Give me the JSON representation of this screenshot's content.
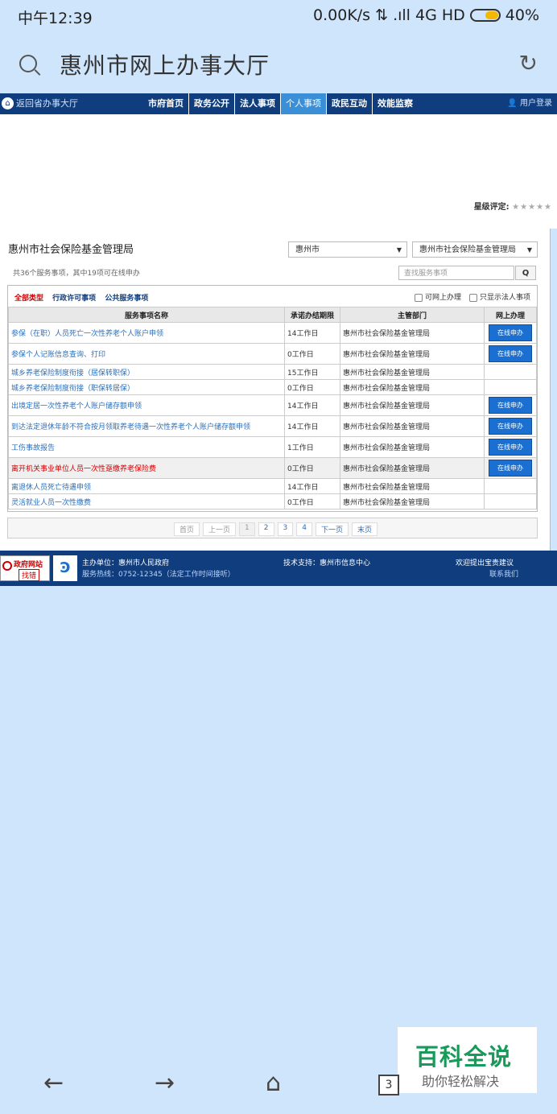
{
  "status_bar": {
    "time": "中午12:39",
    "network": "0.00K/s ⇅ .ıll 4G HD",
    "battery": "40%"
  },
  "browser": {
    "url_title": "惠州市网上办事大厅"
  },
  "nav": {
    "back_label": "返回省办事大厅",
    "items": [
      "市府首页",
      "政务公开",
      "法人事项",
      "个人事项",
      "政民互动",
      "效能监察"
    ],
    "active_item": "个人事项",
    "login_label": "用户登录"
  },
  "rating": {
    "label": "星级评定:",
    "stars": "★★★★★"
  },
  "panel": {
    "title": "惠州市社会保险基金管理局",
    "city_select": "惠州市",
    "dept_select": "惠州市社会保险基金管理局",
    "count_text": "共36个服务事项，其中19项可在线申办",
    "search_placeholder": "查找服务事项",
    "search_button": "Q",
    "filters": [
      "全部类型",
      "行政许可事项",
      "公共服务事项"
    ],
    "check_online": "可网上办理",
    "check_legal": "只显示法人事项",
    "columns": [
      "服务事项名称",
      "承诺办结期限",
      "主管部门",
      "网上办理"
    ],
    "rows": [
      {
        "name": "参保（在职）人员死亡一次性养老个人账户申领",
        "period": "14工作日",
        "dept": "惠州市社会保险基金管理局",
        "apply": "在线申办"
      },
      {
        "name": "参保个人记账信息查询、打印",
        "period": "0工作日",
        "dept": "惠州市社会保险基金管理局",
        "apply": "在线申办"
      },
      {
        "name": "城乡养老保险制度衔接（居保转职保）",
        "period": "15工作日",
        "dept": "惠州市社会保险基金管理局",
        "apply": ""
      },
      {
        "name": "城乡养老保险制度衔接（职保转居保）",
        "period": "0工作日",
        "dept": "惠州市社会保险基金管理局",
        "apply": ""
      },
      {
        "name": "出境定居一次性养老个人账户储存额申领",
        "period": "14工作日",
        "dept": "惠州市社会保险基金管理局",
        "apply": "在线申办"
      },
      {
        "name": "到达法定退休年龄不符合按月领取养老待遇一次性养老个人账户储存额申领",
        "period": "14工作日",
        "dept": "惠州市社会保险基金管理局",
        "apply": "在线申办"
      },
      {
        "name": "工伤事故报告",
        "period": "1工作日",
        "dept": "惠州市社会保险基金管理局",
        "apply": "在线申办"
      },
      {
        "name": "离开机关事业单位人员一次性趸缴养老保险费",
        "period": "0工作日",
        "dept": "惠州市社会保险基金管理局",
        "apply": "在线申办"
      },
      {
        "name": "离退休人员死亡待遇申领",
        "period": "14工作日",
        "dept": "惠州市社会保险基金管理局",
        "apply": ""
      },
      {
        "name": "灵活就业人员一次性缴费",
        "period": "0工作日",
        "dept": "惠州市社会保险基金管理局",
        "apply": ""
      }
    ],
    "pager": [
      "首页",
      "上一页",
      "1",
      "2",
      "3",
      "4",
      "下一页",
      "末页"
    ]
  },
  "footer": {
    "badge_line1": "政府网站",
    "badge_line2": "找错",
    "host": "主办单位：惠州市人民政府",
    "hotline": "服务热线：0752-12345（法定工作时间接听）",
    "tech": "技术支持：惠州市信息中心",
    "suggest": "欢迎提出宝贵建议",
    "contact": "联系我们"
  },
  "watermark": {
    "big": "百科全说",
    "small": "助你轻松解决"
  },
  "bottom_nav": {
    "tabs_count": "3"
  }
}
